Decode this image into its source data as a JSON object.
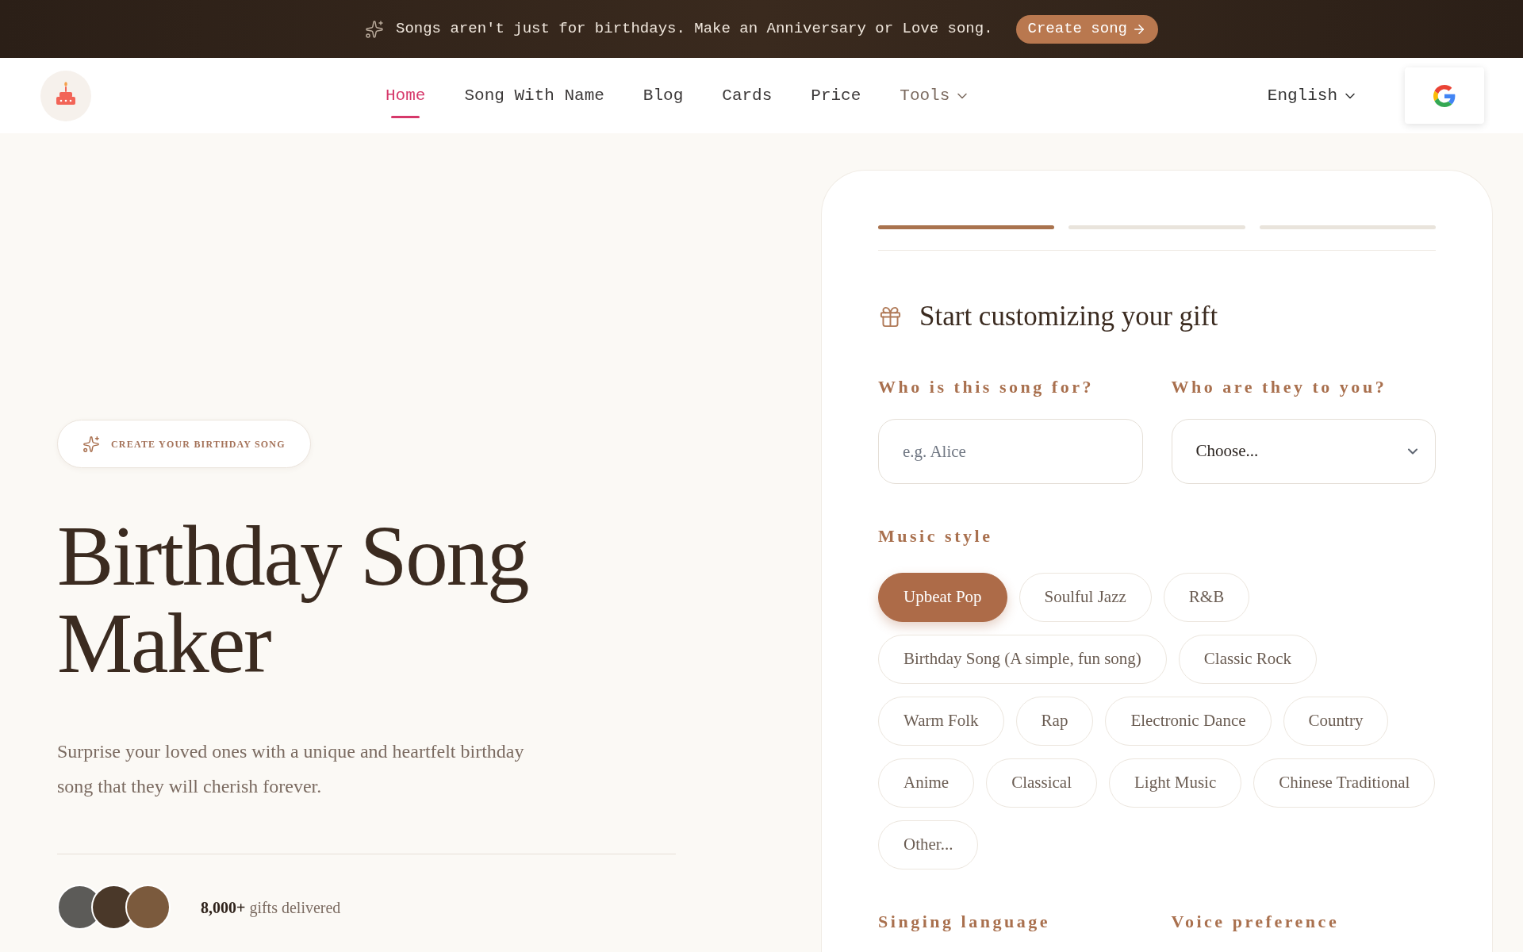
{
  "announcement": {
    "text": "Songs aren't just for birthdays. Make an Anniversary or Love song.",
    "button": "Create song"
  },
  "nav": {
    "items": [
      {
        "label": "Home",
        "kind": "link",
        "selected": true
      },
      {
        "label": "Song With Name",
        "kind": "link",
        "selected": false
      },
      {
        "label": "Blog",
        "kind": "link",
        "selected": false
      },
      {
        "label": "Cards",
        "kind": "link",
        "selected": false
      },
      {
        "label": "Price",
        "kind": "link",
        "selected": false
      },
      {
        "label": "Tools",
        "kind": "dropdown",
        "selected": false
      }
    ],
    "language": "English"
  },
  "hero": {
    "badge": "CREATE YOUR BIRTHDAY SONG",
    "title": "Birthday Song Maker",
    "subtitle": "Surprise your loved ones with a unique and heartfelt birthday song that they will cherish forever.",
    "stat": "**8,000+** gifts delivered"
  },
  "form": {
    "steps": [
      {
        "active": true
      },
      {
        "active": false
      },
      {
        "active": false
      }
    ],
    "heading": "Start customizing your gift",
    "fields": [
      {
        "kind": "text",
        "label": "Who is this song for?",
        "placeholder": "e.g. Alice"
      },
      {
        "kind": "select",
        "label": "Who are they to you?",
        "value": "Choose..."
      }
    ],
    "music_style": {
      "label": "Music style",
      "options": [
        {
          "label": "Upbeat Pop",
          "selected": true
        },
        {
          "label": "Soulful Jazz",
          "selected": false
        },
        {
          "label": "R&B",
          "selected": false
        },
        {
          "label": "Birthday Song (A simple, fun song)",
          "selected": false
        },
        {
          "label": "Classic Rock",
          "selected": false
        },
        {
          "label": "Warm Folk",
          "selected": false
        },
        {
          "label": "Rap",
          "selected": false
        },
        {
          "label": "Electronic Dance",
          "selected": false
        },
        {
          "label": "Country",
          "selected": false
        },
        {
          "label": "Anime",
          "selected": false
        },
        {
          "label": "Classical",
          "selected": false
        },
        {
          "label": "Light Music",
          "selected": false
        },
        {
          "label": "Chinese Traditional",
          "selected": false
        },
        {
          "label": "Other...",
          "selected": false
        }
      ]
    },
    "more_fields": [
      {
        "label": "Singing language"
      },
      {
        "label": "Voice preference"
      }
    ]
  }
}
